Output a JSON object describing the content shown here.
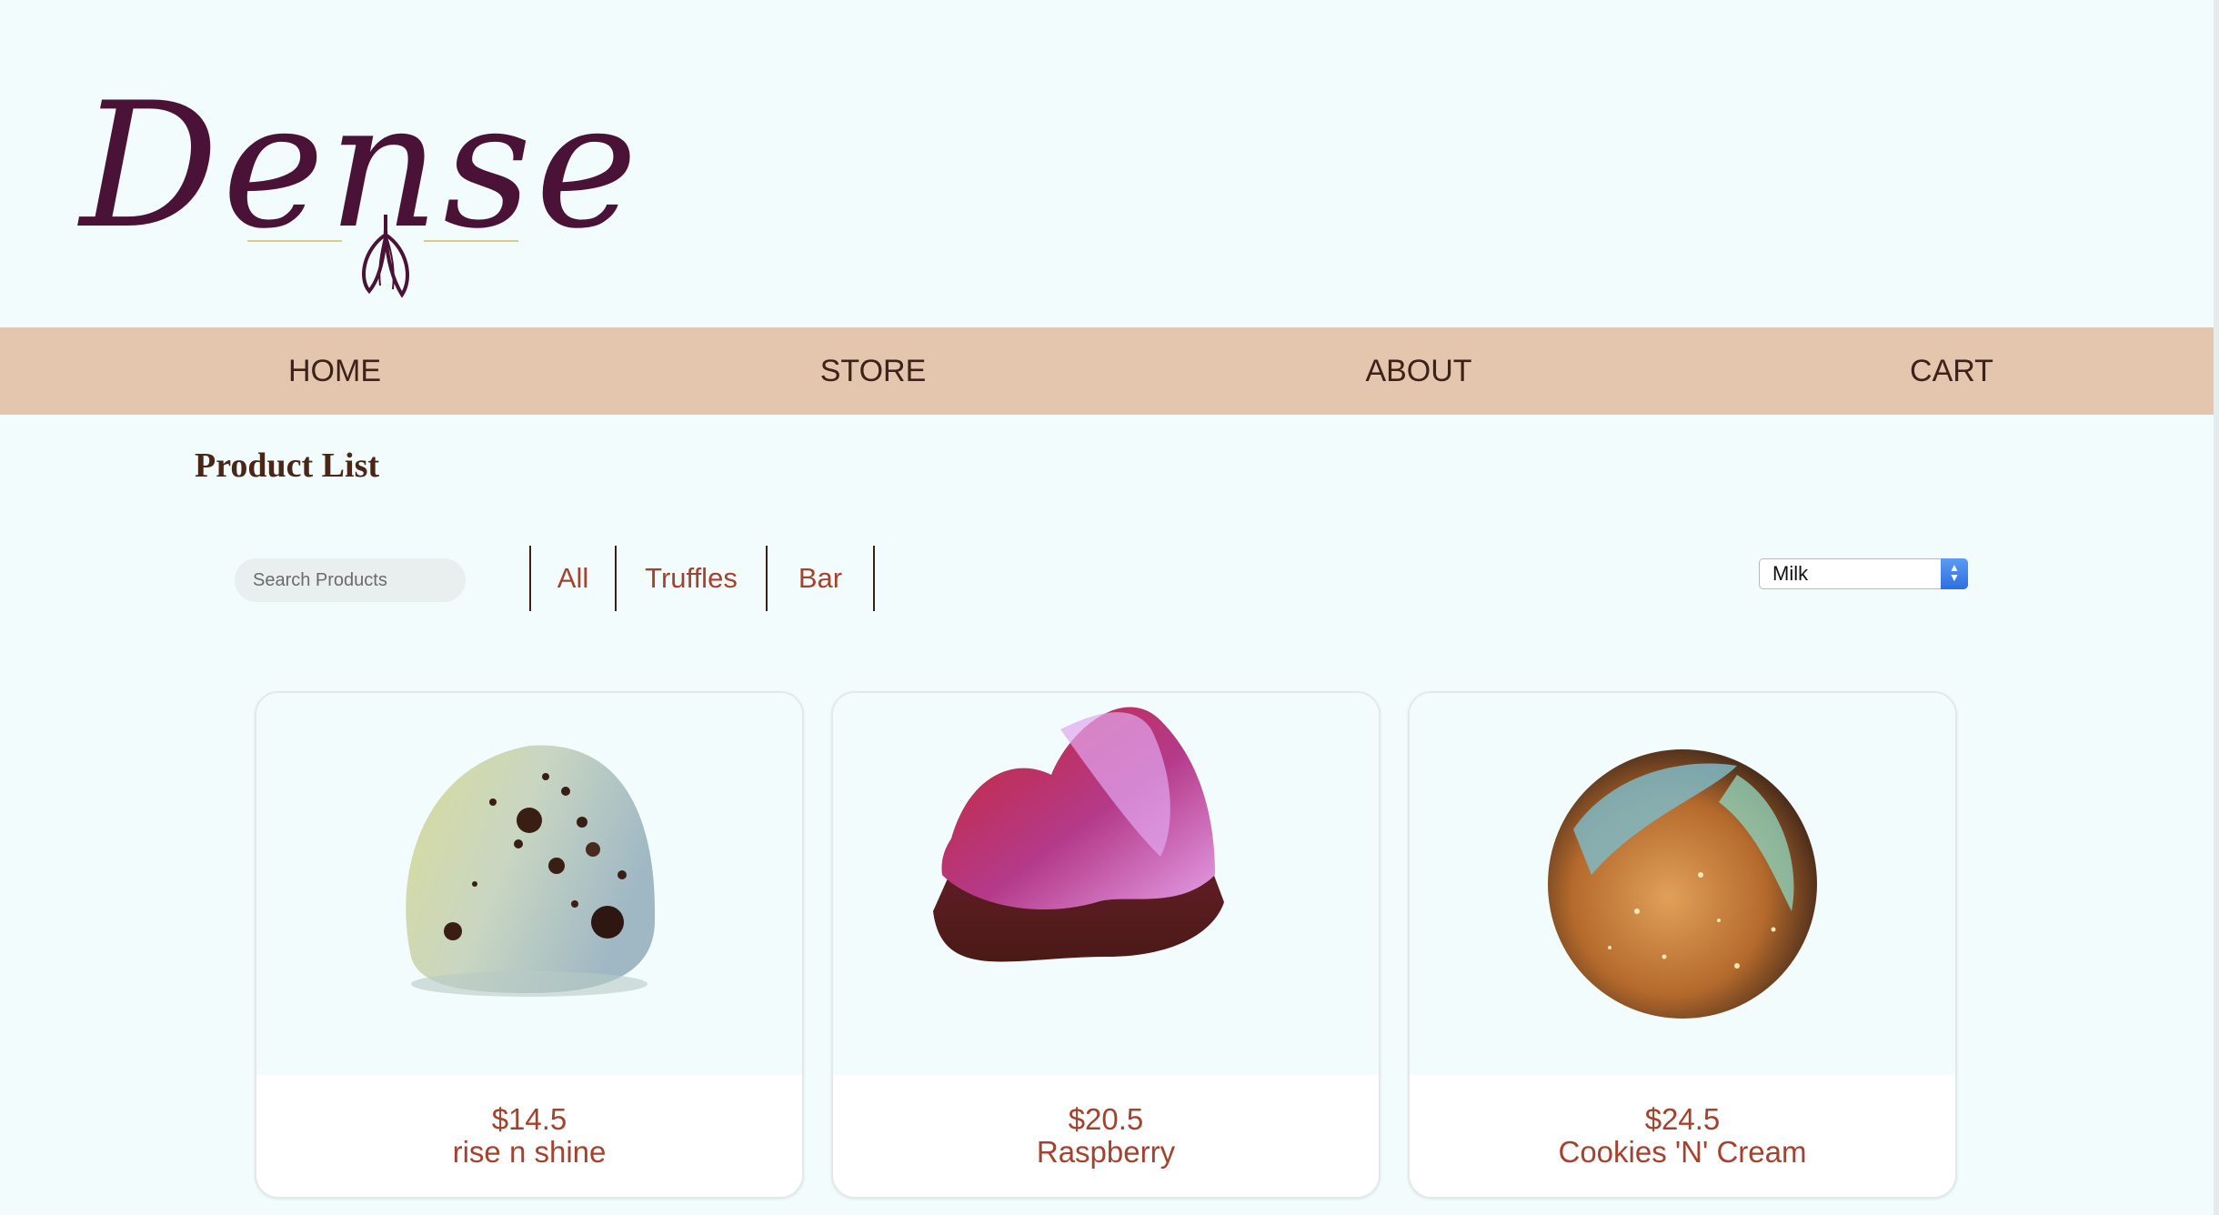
{
  "brand": {
    "logo_text": "Dense"
  },
  "nav": [
    {
      "label": "HOME"
    },
    {
      "label": "STORE"
    },
    {
      "label": "ABOUT"
    },
    {
      "label": "CART"
    }
  ],
  "page_title": "Product List",
  "search": {
    "placeholder": "Search Products",
    "value": ""
  },
  "filters": [
    {
      "label": "All"
    },
    {
      "label": "Truffles"
    },
    {
      "label": "Bar"
    }
  ],
  "sort_select": {
    "value": "Milk"
  },
  "products": [
    {
      "price": "$14.5",
      "name": "rise n shine",
      "image_icon": "speckled-truffle-image"
    },
    {
      "price": "$20.5",
      "name": "Raspberry",
      "image_icon": "heart-bonbon-image"
    },
    {
      "price": "$24.5",
      "name": "Cookies 'N' Cream",
      "image_icon": "sphere-bonbon-image"
    }
  ],
  "colors": {
    "background": "#f2fcfc",
    "navbar": "#e3c6ad",
    "accent_text": "#a5422e",
    "logo": "#4a1236"
  }
}
